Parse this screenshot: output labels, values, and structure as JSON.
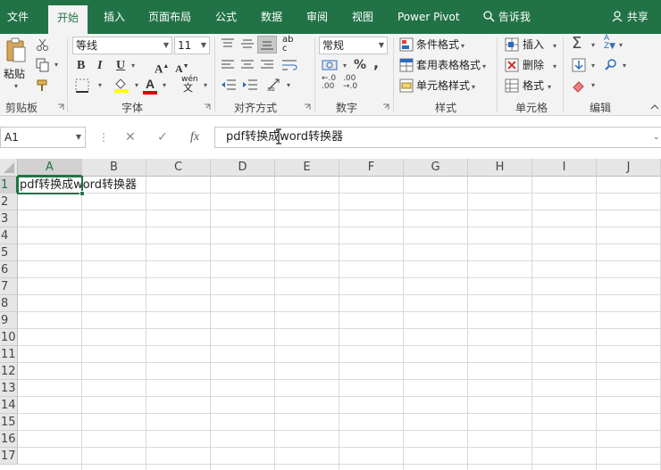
{
  "menu": {
    "tabs": [
      {
        "label": "文件"
      },
      {
        "label": "开始"
      },
      {
        "label": "插入"
      },
      {
        "label": "页面布局"
      },
      {
        "label": "公式"
      },
      {
        "label": "数据"
      },
      {
        "label": "审阅"
      },
      {
        "label": "视图"
      },
      {
        "label": "Power Pivot"
      }
    ],
    "active_tab": "开始",
    "tell_me": "告诉我",
    "share": "共享"
  },
  "ribbon": {
    "clipboard": {
      "label": "剪贴板",
      "paste": "粘贴"
    },
    "font": {
      "label": "字体",
      "font_name": "等线",
      "font_size": "11",
      "bold": "B",
      "italic": "I",
      "underline": "U",
      "phonetic": "wén"
    },
    "alignment": {
      "label": "对齐方式"
    },
    "number": {
      "label": "数字",
      "format": "常规",
      "percent": "%"
    },
    "styles": {
      "label": "样式",
      "conditional": "条件格式",
      "table": "套用表格格式",
      "cell_styles": "单元格样式"
    },
    "cells": {
      "label": "单元格",
      "insert": "插入",
      "delete": "删除",
      "format": "格式"
    },
    "editing": {
      "label": "编辑"
    }
  },
  "formula_bar": {
    "name_box": "A1",
    "fx": "fx",
    "content": "pdf转换成word转换器"
  },
  "grid": {
    "columns": [
      "A",
      "B",
      "C",
      "D",
      "E",
      "F",
      "G",
      "H",
      "I",
      "J"
    ],
    "rows": [
      "1",
      "2",
      "3",
      "4",
      "5",
      "6",
      "7",
      "8",
      "9",
      "10",
      "11",
      "12",
      "13",
      "14",
      "15",
      "16",
      "17"
    ],
    "active_cell": "A1",
    "cells": {
      "A1": "pdf转换成word转换器"
    }
  },
  "colors": {
    "accent": "#217346",
    "ribbon_bg": "#f3f3f3",
    "font_color_bar": "#e00000",
    "fill_color_bar": "#ffff00"
  }
}
